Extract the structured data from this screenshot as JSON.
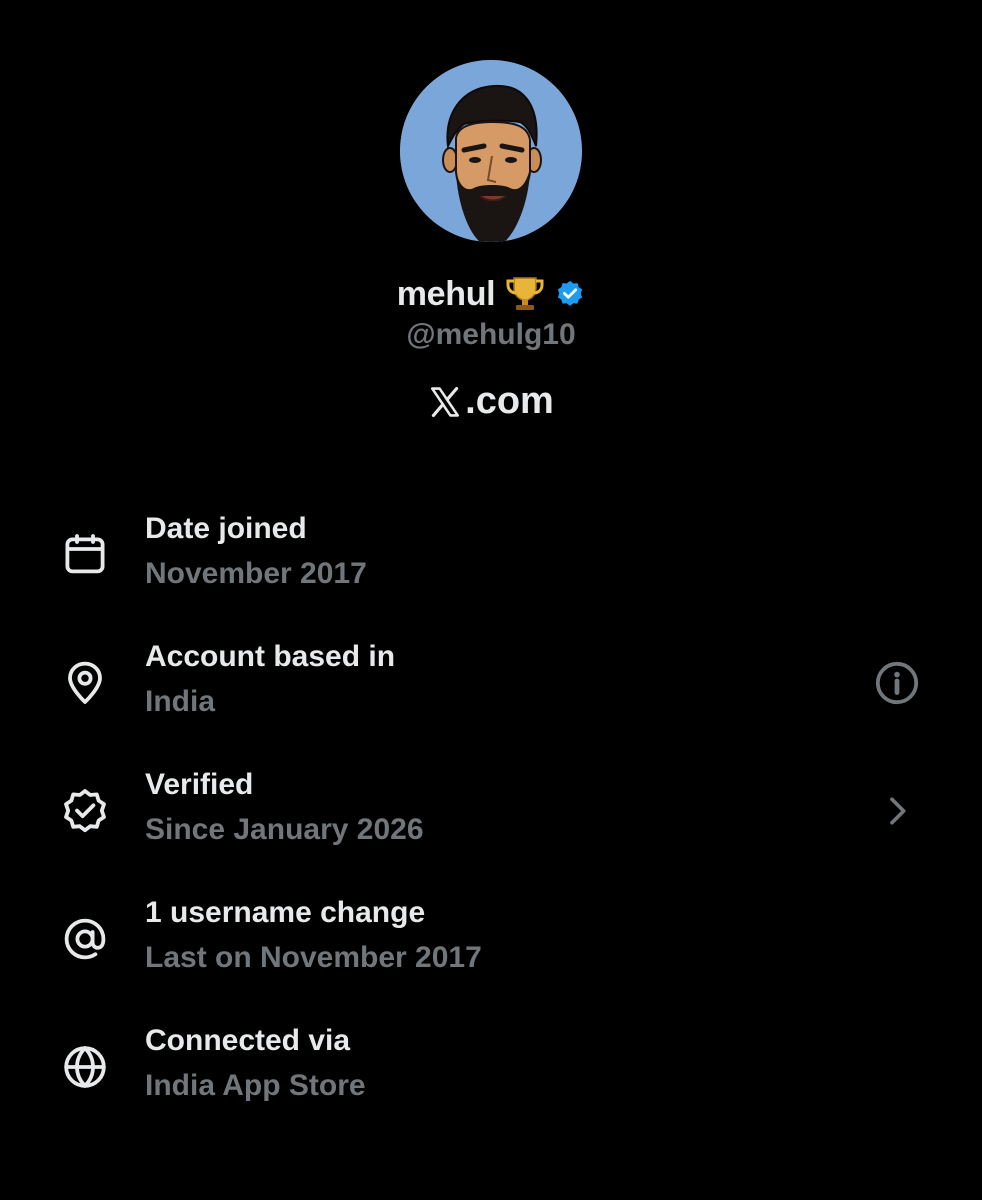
{
  "profile": {
    "display_name": "mehul",
    "handle": "@mehulg10",
    "site_suffix": ".com",
    "avatar_bg": "#7aa6d9"
  },
  "colors": {
    "background": "#000000",
    "primary_text": "#e7e9ea",
    "secondary_text": "#71767b",
    "verified_blue": "#1d9bf0"
  },
  "rows": [
    {
      "icon": "calendar-icon",
      "title": "Date joined",
      "subtitle": "November 2017"
    },
    {
      "icon": "location-pin-icon",
      "title": "Account based in",
      "subtitle": "India",
      "action_icon": "info-icon"
    },
    {
      "icon": "verified-outline-icon",
      "title": "Verified",
      "subtitle": "Since January 2026",
      "action_icon": "chevron-right-icon"
    },
    {
      "icon": "at-sign-icon",
      "title": "1 username change",
      "subtitle": "Last on November 2017"
    },
    {
      "icon": "globe-icon",
      "title": "Connected via",
      "subtitle": "India App Store"
    }
  ]
}
